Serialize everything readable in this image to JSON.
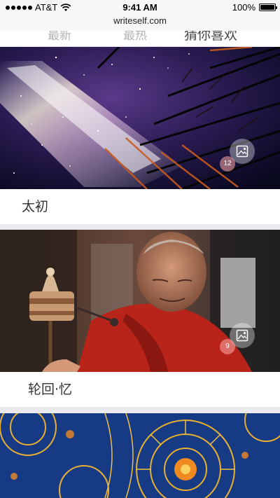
{
  "status_bar": {
    "carrier": "AT&T",
    "time": "9:41 AM",
    "battery": "100%",
    "battery_level": 1.0,
    "wifi_icon": "wifi-icon",
    "signal_icon": "signal-dots-icon"
  },
  "browser": {
    "url": "writeself.com"
  },
  "tabs": [
    {
      "label": "最新"
    },
    {
      "label": "最热"
    },
    {
      "label": "猜你喜欢",
      "active": true
    }
  ],
  "feed": [
    {
      "title": "太初",
      "count": "12",
      "image": "starry-sky-trees-photo",
      "icon": "gallery-icon"
    },
    {
      "title": "轮回·忆",
      "count": "9",
      "image": "monk-prayer-wheel-photo",
      "icon": "gallery-icon"
    },
    {
      "title": "",
      "count": "",
      "image": "mandala-pattern-artwork"
    }
  ],
  "colors": {
    "separator": "#eaeaee",
    "badge": "#ffaaaa",
    "text": "#333333"
  }
}
